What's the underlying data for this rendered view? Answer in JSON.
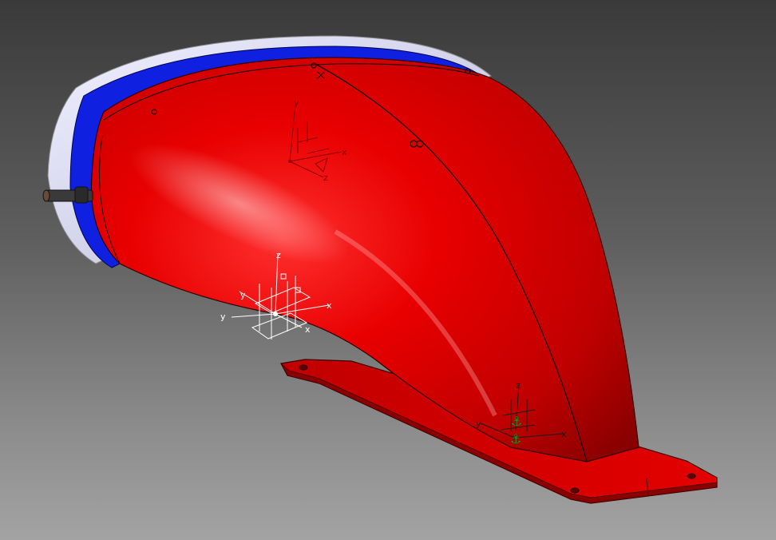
{
  "viewport": {
    "background_top": "#3a3a3a",
    "background_bottom": "#a3a3a3"
  },
  "part": {
    "shell_color": "#e00000",
    "flange_color": "#d20000",
    "band_blue": "#1020e0",
    "cap_color": "#d8d8f0",
    "edge_color": "#000000"
  },
  "axis_systems": [
    {
      "id": "upper",
      "color": "#8a0000",
      "labels": {
        "x": "x",
        "y": "y",
        "z": "z"
      }
    },
    {
      "id": "middle",
      "color": "#ffffff",
      "labels": {
        "x": "x",
        "y": "y",
        "z": "z",
        "x2": "x",
        "y2": "y"
      }
    },
    {
      "id": "lower",
      "color": "#1a1a1a",
      "labels": {
        "x": "x",
        "y": "y",
        "z": "z"
      }
    }
  ],
  "constraints": [
    {
      "icon": "anchor-icon",
      "glyph": "⚓",
      "color": "#22c022"
    },
    {
      "icon": "anchor-icon",
      "glyph": "⚓",
      "color": "#22c022"
    }
  ]
}
